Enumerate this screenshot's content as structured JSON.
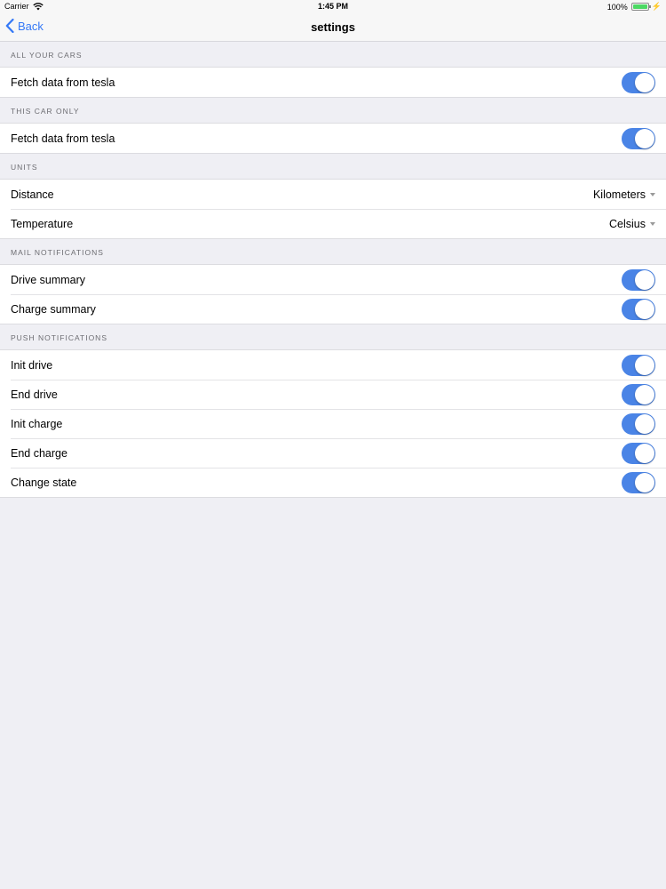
{
  "status_bar": {
    "carrier": "Carrier",
    "time": "1:45 PM",
    "battery": "100%",
    "battery_level": 1.0
  },
  "nav": {
    "back_label": "Back",
    "title": "settings"
  },
  "sections": {
    "all_cars": {
      "header": "ALL YOUR CARS",
      "fetch_label": "Fetch data from tesla",
      "fetch_on": true
    },
    "this_car": {
      "header": "THIS CAR ONLY",
      "fetch_label": "Fetch data from tesla",
      "fetch_on": true
    },
    "units": {
      "header": "UNITS",
      "distance_label": "Distance",
      "distance_value": "Kilometers",
      "temperature_label": "Temperature",
      "temperature_value": "Celsius"
    },
    "mail": {
      "header": "MAIL NOTIFICATIONS",
      "drive_summary_label": "Drive summary",
      "charge_summary_label": "Charge summary"
    },
    "push": {
      "header": "PUSH NOTIFICATIONS",
      "init_drive_label": "Init drive",
      "end_drive_label": "End drive",
      "init_charge_label": "Init charge",
      "end_charge_label": "End charge",
      "change_state_label": "Change state"
    }
  },
  "colors": {
    "accent": "#3478f6",
    "toggle_on": "#4a84e6",
    "background": "#efeff4"
  },
  "icons": {
    "wifi": "wifi-icon",
    "battery": "battery-icon",
    "charging": "charging-bolt-icon",
    "back": "chevron-left-icon",
    "dropdown": "caret-down-icon"
  }
}
